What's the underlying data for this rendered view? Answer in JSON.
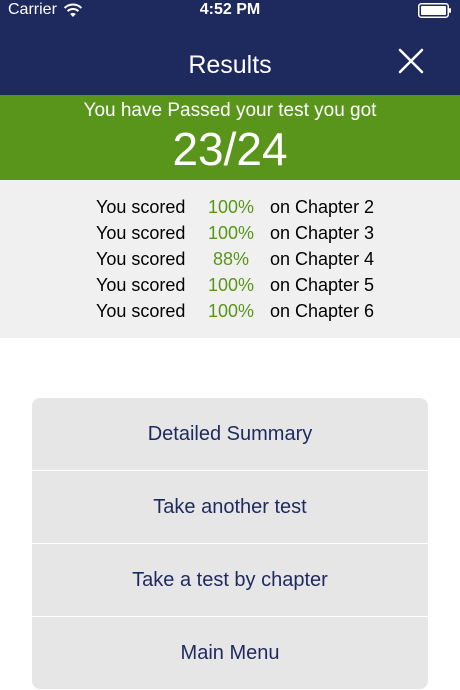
{
  "status_bar": {
    "carrier": "Carrier",
    "time": "4:52 PM"
  },
  "nav": {
    "title": "Results"
  },
  "result": {
    "message": "You have Passed your test you got",
    "score": "23/24"
  },
  "chapter_scores": [
    {
      "prefix": "You scored",
      "percent": "100%",
      "chapter": "on Chapter 2"
    },
    {
      "prefix": "You scored",
      "percent": "100%",
      "chapter": "on Chapter 3"
    },
    {
      "prefix": "You scored",
      "percent": "88%",
      "chapter": "on Chapter 4"
    },
    {
      "prefix": "You scored",
      "percent": "100%",
      "chapter": "on Chapter 5"
    },
    {
      "prefix": "You scored",
      "percent": "100%",
      "chapter": "on Chapter 6"
    }
  ],
  "menu": {
    "detailed_summary": "Detailed Summary",
    "take_another_test": "Take another test",
    "take_test_by_chapter": "Take a test by chapter",
    "main_menu": "Main Menu"
  },
  "colors": {
    "header_bg": "#1e2a5e",
    "pass_green": "#5a951b",
    "panel_bg": "#f0f0f0",
    "menu_bg": "#e6e6e6"
  },
  "icons": [
    "wifi-icon",
    "battery-icon",
    "close-icon"
  ]
}
